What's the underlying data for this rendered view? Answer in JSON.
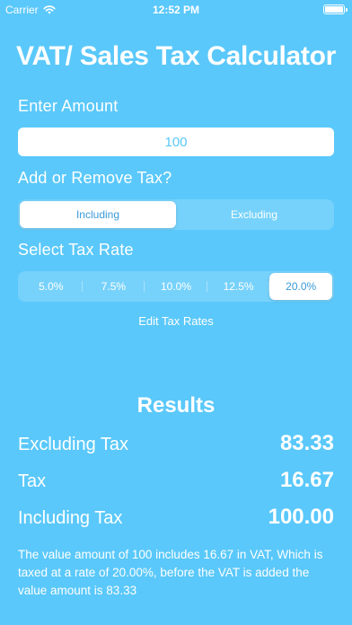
{
  "status_bar": {
    "carrier": "Carrier",
    "time": "12:52 PM"
  },
  "title": "VAT/ Sales Tax Calculator",
  "amount": {
    "label": "Enter Amount",
    "value": "100"
  },
  "tax_mode": {
    "label": "Add or Remove Tax?",
    "options": [
      "Including",
      "Excluding"
    ],
    "selected": "Including"
  },
  "tax_rate": {
    "label": "Select Tax Rate",
    "options": [
      "5.0%",
      "7.5%",
      "10.0%",
      "12.5%",
      "20.0%"
    ],
    "selected": "20.0%"
  },
  "edit_rates_label": "Edit Tax Rates",
  "results": {
    "title": "Results",
    "rows": [
      {
        "label": "Excluding Tax",
        "value": "83.33"
      },
      {
        "label": "Tax",
        "value": "16.67"
      },
      {
        "label": "Including Tax",
        "value": "100.00"
      }
    ]
  },
  "summary": "The value amount of 100 includes 16.67 in VAT, Which is taxed at a rate of 20.00%, before the VAT is added the value amount is 83.33",
  "colors": {
    "background": "#5ac8fa",
    "accent_text": "#3a9ad9"
  }
}
